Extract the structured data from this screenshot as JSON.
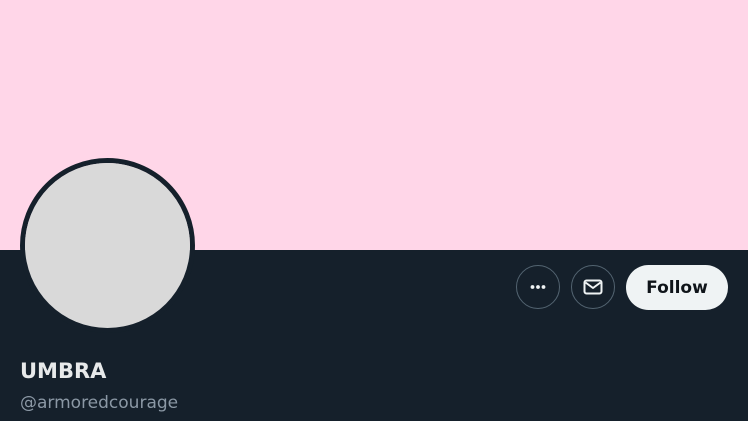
{
  "profile": {
    "banner_color": "#ffd6e8",
    "background_color": "#15202b",
    "display_name": "UMBRA",
    "handle": "@armoredcourage"
  },
  "actions": {
    "more_icon": "more-horizontal-icon",
    "message_icon": "envelope-icon",
    "follow_label": "Follow"
  },
  "colors": {
    "follow_button_bg": "#eff3f4",
    "follow_button_text": "#0f1419",
    "name_text": "#e7e9ea",
    "handle_text": "#8b98a5",
    "icon_button_border": "#536471"
  }
}
